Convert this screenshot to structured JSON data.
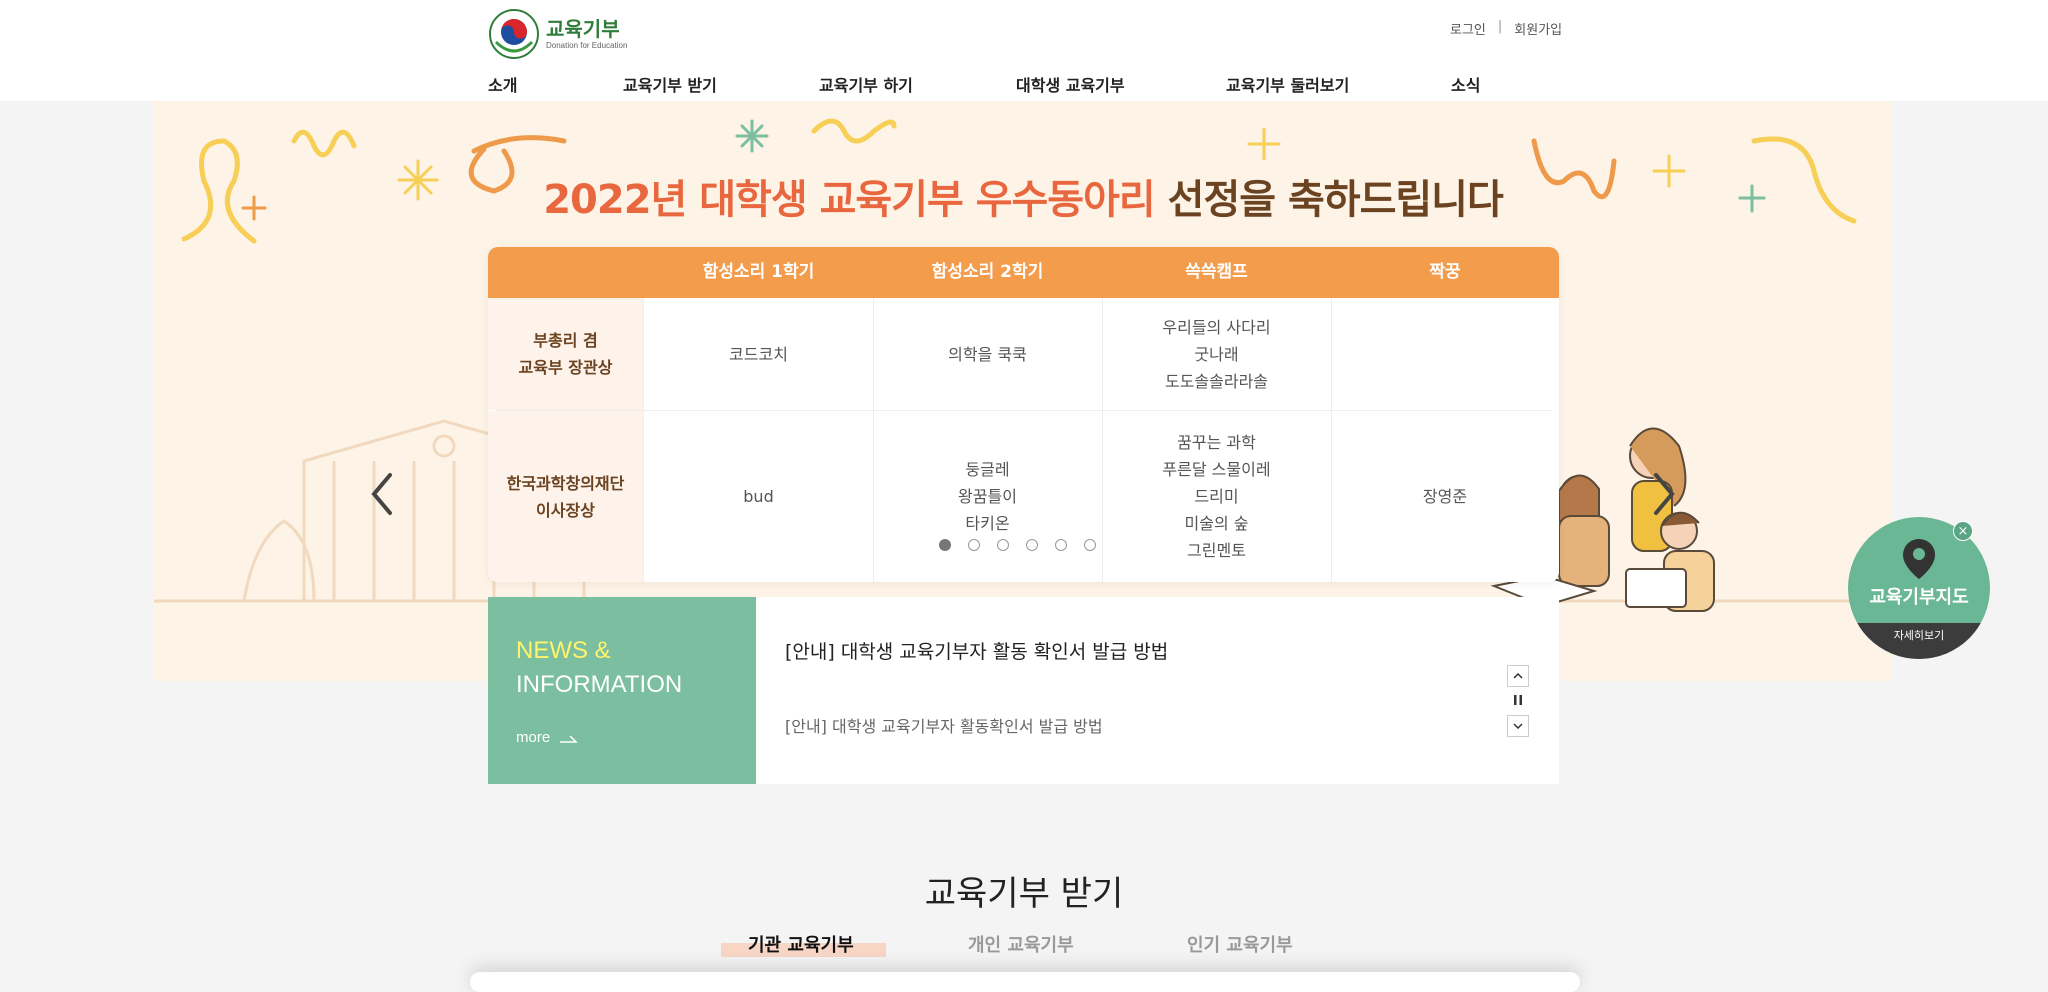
{
  "header": {
    "logo_title": "교육기부",
    "logo_sub": "Donation for Education",
    "login": "로그인",
    "separator": "|",
    "signup": "회원가입",
    "nav": [
      "소개",
      "교육기부 받기",
      "교육기부 하기",
      "대학생 교육기부",
      "교육기부 둘러보기",
      "소식"
    ]
  },
  "visual": {
    "headline_part1": "2022년 대학생 교육기부 우수동아리",
    "headline_part2": " 선정을 축하드립니다",
    "table": {
      "columns": [
        "함성소리 1학기",
        "함성소리 2학기",
        "쓱쓱캠프",
        "짝꿍"
      ],
      "rows": [
        {
          "label": "부총리 겸\n교육부 장관상",
          "cells": [
            "코드코치",
            "의학을 쿡쿡",
            "우리들의 사다리\n굿나래\n도도솔솔라라솔",
            ""
          ]
        },
        {
          "label": "한국과학창의재단\n이사장상",
          "cells": [
            "bud",
            "둥글레\n왕꿈틀이\n타키온",
            "꿈꾸는 과학\n푸른달 스물이레\n드리미\n미술의 숲\n그린멘토",
            "장영준"
          ]
        }
      ]
    },
    "slider": {
      "total": 6,
      "active": 1
    }
  },
  "news": {
    "title_line1": "NEWS &",
    "title_line2": "INFORMATION",
    "more": "more",
    "item1": "[안내] 대학생 교육기부자 활동 확인서 발급 방법",
    "item2": "[안내] 대학생 교육기부자 활동확인서 발급 방법"
  },
  "map_badge": {
    "title": "교육기부지도",
    "more": "자세히보기",
    "close": "×"
  },
  "section": {
    "title": "교육기부 받기",
    "tabs": [
      "기관 교육기부",
      "개인 교육기부",
      "인기 교육기부"
    ],
    "active_tab": 0
  },
  "colors": {
    "accent_orange": "#f39c4c",
    "news_green": "#7bbfa0",
    "visual_bg": "#fdf3e6",
    "headline_orange": "#e9673e",
    "headline_brown": "#6b4321"
  }
}
